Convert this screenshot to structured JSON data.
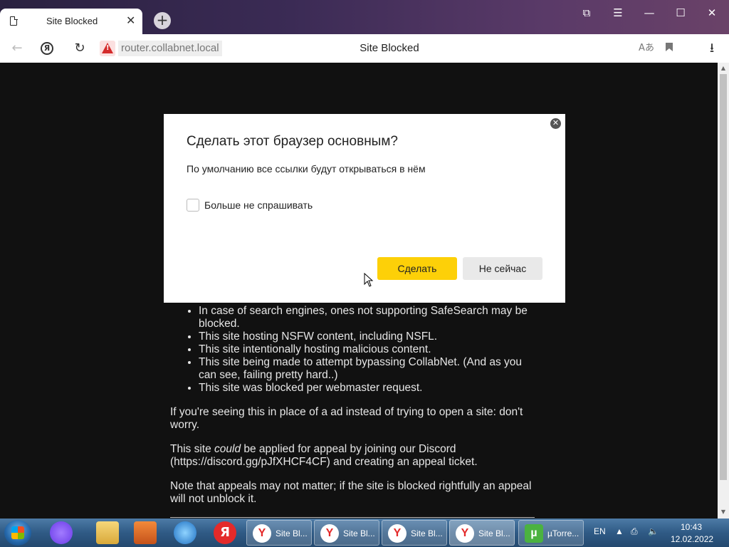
{
  "browser": {
    "tab_title": "Site Blocked",
    "tab_close": "✕",
    "new_tab": "+",
    "url": "router.collabnet.local",
    "page_title": "Site Blocked",
    "window_controls": [
      "⧉",
      "☰",
      "—",
      "☐",
      "✕"
    ]
  },
  "page": {
    "bullets": [
      "In case of search engines, ones not supporting SafeSearch may be blocked.",
      "This site hosting NSFW content, including NSFL.",
      "This site intentionally hosting malicious content.",
      "This site being made to attempt bypassing CollabNet. (And as you can see, failing pretty hard..)",
      "This site was blocked per webmaster request."
    ],
    "para1": "If you're seeing this in place of a ad instead of trying to open a site: don't worry.",
    "para2_a": "This site ",
    "para2_em": "could",
    "para2_b": " be applied for appeal by joining our Discord (https://discord.gg/pJfXHCF4CF) and creating an appeal ticket.",
    "para3": "Note that appeals may not matter; if the site is blocked rightfully an appeal will not unblock it."
  },
  "dialog": {
    "title": "Сделать этот браузер основным?",
    "subtitle": "По умолчанию все ссылки будут открываться в нём",
    "checkbox_label": "Больше не спрашивать",
    "primary_button": "Сделать",
    "secondary_button": "Не сейчас"
  },
  "taskbar": {
    "buttons": [
      "Site Bl...",
      "Site Bl...",
      "Site Bl...",
      "Site Bl...",
      "µTorre..."
    ],
    "language": "EN",
    "time": "10:43",
    "date": "12.02.2022"
  }
}
